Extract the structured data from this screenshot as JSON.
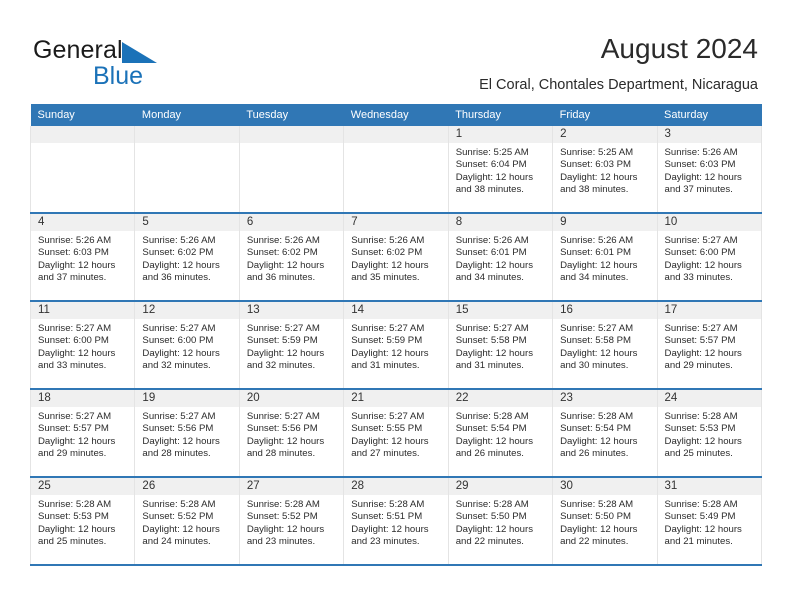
{
  "brand": {
    "name_part1": "General",
    "name_part2": "Blue",
    "accent_color": "#1b72b8"
  },
  "header": {
    "title": "August 2024",
    "subtitle": "El Coral, Chontales Department, Nicaragua",
    "header_bg_color": "#3077b5"
  },
  "calendar": {
    "weekday_headers": [
      "Sunday",
      "Monday",
      "Tuesday",
      "Wednesday",
      "Thursday",
      "Friday",
      "Saturday"
    ],
    "weeks": [
      [
        {
          "day": "",
          "empty": true
        },
        {
          "day": "",
          "empty": true
        },
        {
          "day": "",
          "empty": true
        },
        {
          "day": "",
          "empty": true
        },
        {
          "day": "1",
          "sunrise": "Sunrise: 5:25 AM",
          "sunset": "Sunset: 6:04 PM",
          "daylight1": "Daylight: 12 hours",
          "daylight2": "and 38 minutes."
        },
        {
          "day": "2",
          "sunrise": "Sunrise: 5:25 AM",
          "sunset": "Sunset: 6:03 PM",
          "daylight1": "Daylight: 12 hours",
          "daylight2": "and 38 minutes."
        },
        {
          "day": "3",
          "sunrise": "Sunrise: 5:26 AM",
          "sunset": "Sunset: 6:03 PM",
          "daylight1": "Daylight: 12 hours",
          "daylight2": "and 37 minutes."
        }
      ],
      [
        {
          "day": "4",
          "sunrise": "Sunrise: 5:26 AM",
          "sunset": "Sunset: 6:03 PM",
          "daylight1": "Daylight: 12 hours",
          "daylight2": "and 37 minutes."
        },
        {
          "day": "5",
          "sunrise": "Sunrise: 5:26 AM",
          "sunset": "Sunset: 6:02 PM",
          "daylight1": "Daylight: 12 hours",
          "daylight2": "and 36 minutes."
        },
        {
          "day": "6",
          "sunrise": "Sunrise: 5:26 AM",
          "sunset": "Sunset: 6:02 PM",
          "daylight1": "Daylight: 12 hours",
          "daylight2": "and 36 minutes."
        },
        {
          "day": "7",
          "sunrise": "Sunrise: 5:26 AM",
          "sunset": "Sunset: 6:02 PM",
          "daylight1": "Daylight: 12 hours",
          "daylight2": "and 35 minutes."
        },
        {
          "day": "8",
          "sunrise": "Sunrise: 5:26 AM",
          "sunset": "Sunset: 6:01 PM",
          "daylight1": "Daylight: 12 hours",
          "daylight2": "and 34 minutes."
        },
        {
          "day": "9",
          "sunrise": "Sunrise: 5:26 AM",
          "sunset": "Sunset: 6:01 PM",
          "daylight1": "Daylight: 12 hours",
          "daylight2": "and 34 minutes."
        },
        {
          "day": "10",
          "sunrise": "Sunrise: 5:27 AM",
          "sunset": "Sunset: 6:00 PM",
          "daylight1": "Daylight: 12 hours",
          "daylight2": "and 33 minutes."
        }
      ],
      [
        {
          "day": "11",
          "sunrise": "Sunrise: 5:27 AM",
          "sunset": "Sunset: 6:00 PM",
          "daylight1": "Daylight: 12 hours",
          "daylight2": "and 33 minutes."
        },
        {
          "day": "12",
          "sunrise": "Sunrise: 5:27 AM",
          "sunset": "Sunset: 6:00 PM",
          "daylight1": "Daylight: 12 hours",
          "daylight2": "and 32 minutes."
        },
        {
          "day": "13",
          "sunrise": "Sunrise: 5:27 AM",
          "sunset": "Sunset: 5:59 PM",
          "daylight1": "Daylight: 12 hours",
          "daylight2": "and 32 minutes."
        },
        {
          "day": "14",
          "sunrise": "Sunrise: 5:27 AM",
          "sunset": "Sunset: 5:59 PM",
          "daylight1": "Daylight: 12 hours",
          "daylight2": "and 31 minutes."
        },
        {
          "day": "15",
          "sunrise": "Sunrise: 5:27 AM",
          "sunset": "Sunset: 5:58 PM",
          "daylight1": "Daylight: 12 hours",
          "daylight2": "and 31 minutes."
        },
        {
          "day": "16",
          "sunrise": "Sunrise: 5:27 AM",
          "sunset": "Sunset: 5:58 PM",
          "daylight1": "Daylight: 12 hours",
          "daylight2": "and 30 minutes."
        },
        {
          "day": "17",
          "sunrise": "Sunrise: 5:27 AM",
          "sunset": "Sunset: 5:57 PM",
          "daylight1": "Daylight: 12 hours",
          "daylight2": "and 29 minutes."
        }
      ],
      [
        {
          "day": "18",
          "sunrise": "Sunrise: 5:27 AM",
          "sunset": "Sunset: 5:57 PM",
          "daylight1": "Daylight: 12 hours",
          "daylight2": "and 29 minutes."
        },
        {
          "day": "19",
          "sunrise": "Sunrise: 5:27 AM",
          "sunset": "Sunset: 5:56 PM",
          "daylight1": "Daylight: 12 hours",
          "daylight2": "and 28 minutes."
        },
        {
          "day": "20",
          "sunrise": "Sunrise: 5:27 AM",
          "sunset": "Sunset: 5:56 PM",
          "daylight1": "Daylight: 12 hours",
          "daylight2": "and 28 minutes."
        },
        {
          "day": "21",
          "sunrise": "Sunrise: 5:27 AM",
          "sunset": "Sunset: 5:55 PM",
          "daylight1": "Daylight: 12 hours",
          "daylight2": "and 27 minutes."
        },
        {
          "day": "22",
          "sunrise": "Sunrise: 5:28 AM",
          "sunset": "Sunset: 5:54 PM",
          "daylight1": "Daylight: 12 hours",
          "daylight2": "and 26 minutes."
        },
        {
          "day": "23",
          "sunrise": "Sunrise: 5:28 AM",
          "sunset": "Sunset: 5:54 PM",
          "daylight1": "Daylight: 12 hours",
          "daylight2": "and 26 minutes."
        },
        {
          "day": "24",
          "sunrise": "Sunrise: 5:28 AM",
          "sunset": "Sunset: 5:53 PM",
          "daylight1": "Daylight: 12 hours",
          "daylight2": "and 25 minutes."
        }
      ],
      [
        {
          "day": "25",
          "sunrise": "Sunrise: 5:28 AM",
          "sunset": "Sunset: 5:53 PM",
          "daylight1": "Daylight: 12 hours",
          "daylight2": "and 25 minutes."
        },
        {
          "day": "26",
          "sunrise": "Sunrise: 5:28 AM",
          "sunset": "Sunset: 5:52 PM",
          "daylight1": "Daylight: 12 hours",
          "daylight2": "and 24 minutes."
        },
        {
          "day": "27",
          "sunrise": "Sunrise: 5:28 AM",
          "sunset": "Sunset: 5:52 PM",
          "daylight1": "Daylight: 12 hours",
          "daylight2": "and 23 minutes."
        },
        {
          "day": "28",
          "sunrise": "Sunrise: 5:28 AM",
          "sunset": "Sunset: 5:51 PM",
          "daylight1": "Daylight: 12 hours",
          "daylight2": "and 23 minutes."
        },
        {
          "day": "29",
          "sunrise": "Sunrise: 5:28 AM",
          "sunset": "Sunset: 5:50 PM",
          "daylight1": "Daylight: 12 hours",
          "daylight2": "and 22 minutes."
        },
        {
          "day": "30",
          "sunrise": "Sunrise: 5:28 AM",
          "sunset": "Sunset: 5:50 PM",
          "daylight1": "Daylight: 12 hours",
          "daylight2": "and 22 minutes."
        },
        {
          "day": "31",
          "sunrise": "Sunrise: 5:28 AM",
          "sunset": "Sunset: 5:49 PM",
          "daylight1": "Daylight: 12 hours",
          "daylight2": "and 21 minutes."
        }
      ]
    ]
  }
}
